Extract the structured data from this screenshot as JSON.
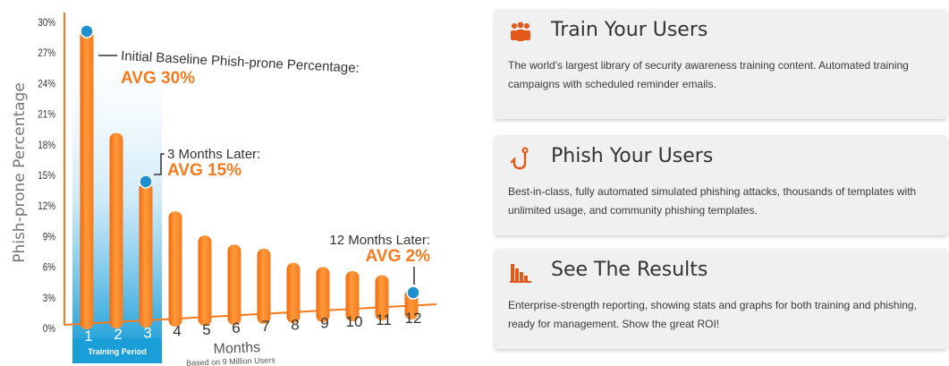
{
  "chart_data": {
    "type": "bar",
    "ylabel": "Phish-prone Percentage",
    "xlabel": "Months",
    "x_note": "Based on 9 Million Users",
    "y_ticks": [
      "0%",
      "3%",
      "6%",
      "9%",
      "12%",
      "15%",
      "18%",
      "21%",
      "24%",
      "27%",
      "30%"
    ],
    "ylim": [
      0,
      30
    ],
    "categories": [
      "1",
      "2",
      "3",
      "4",
      "5",
      "6",
      "7",
      "8",
      "9",
      "10",
      "11",
      "12"
    ],
    "values": [
      30,
      19.5,
      14.5,
      11.5,
      9,
      8,
      7.5,
      6,
      5.5,
      5,
      4.5,
      3
    ],
    "training_period_label": "Training Period",
    "annotations": [
      {
        "point": 1,
        "text": "Initial Baseline Phish-prone Percentage:",
        "value_text": "AVG 30%"
      },
      {
        "point": 3,
        "text": "3 Months Later:",
        "value_text": "AVG 15%"
      },
      {
        "point": 12,
        "text": "12 Months Later:",
        "value_text": "AVG 2%"
      }
    ],
    "colors": {
      "bar": "#f47b20",
      "bar_light": "#ffb060",
      "marker": "#1e90d0",
      "training_band": "#1a9ed8",
      "axis": "#f47b20",
      "highlight_text": "#f47b20"
    }
  },
  "cards": [
    {
      "icon": "users-icon",
      "title": "Train Your Users",
      "description": "The world's largest library of security awareness training content. Automated training campaigns with scheduled reminder emails."
    },
    {
      "icon": "fishhook-icon",
      "title": "Phish Your Users",
      "description": "Best-in-class, fully automated simulated phishing attacks, thousands of templates with unlimited usage, and community phishing templates."
    },
    {
      "icon": "results-chart-icon",
      "title": "See The Results",
      "description": "Enterprise-strength reporting, showing stats and graphs for both training and phishing, ready for management. Show the great ROI!"
    }
  ]
}
